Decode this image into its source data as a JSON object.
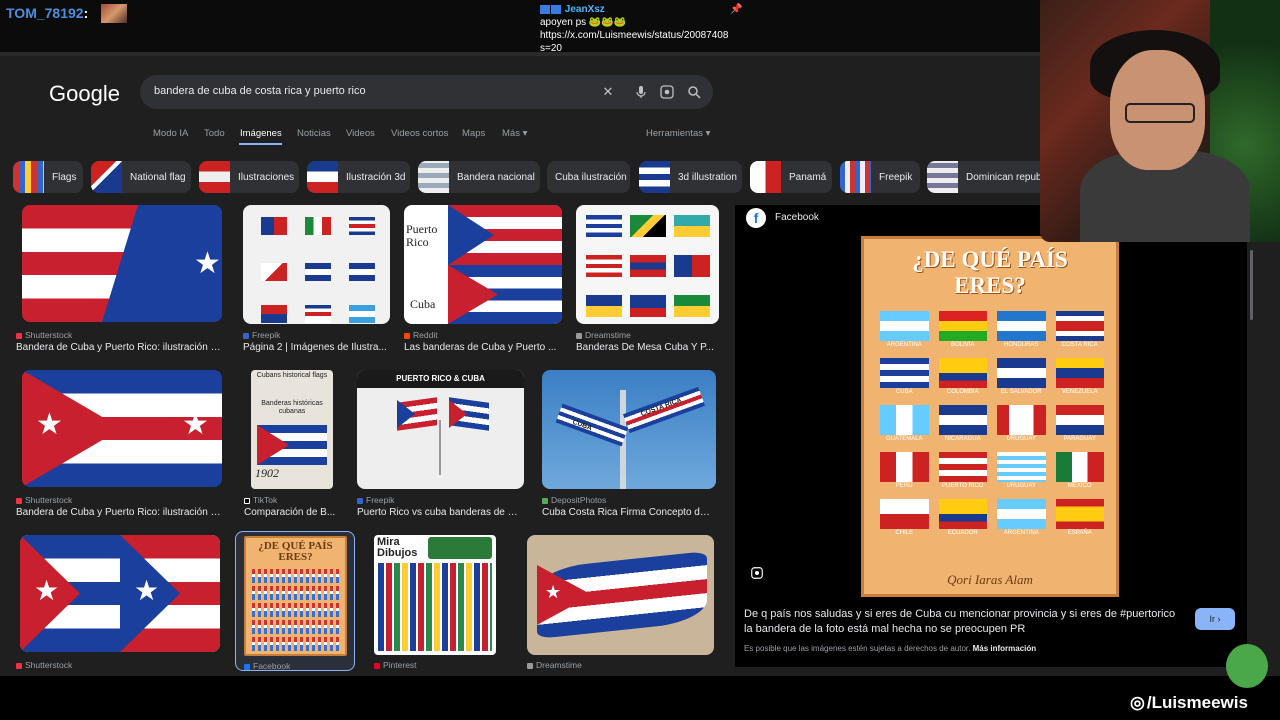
{
  "overlay": {
    "chat_user": "TOM_78192",
    "chat_colon": ":",
    "pinned_nick": "JeanXsz",
    "pinned_line1": "apoyen ps 🐸🐸🐸",
    "pinned_line2": "https://x.com/Luismeewis/status/20087408",
    "pinned_line3": "s=20",
    "social_handle": "/Luismeewis"
  },
  "google": {
    "logo": "Google",
    "query": "bandera de cuba de costa rica y puerto rico",
    "tabs": [
      "Modo IA",
      "Todo",
      "Imágenes",
      "Noticias",
      "Videos",
      "Videos cortos",
      "Maps",
      "Más ▾"
    ],
    "active_tab": "Imágenes",
    "tools": "Herramientas ▾",
    "chips": [
      "Flags",
      "National flag",
      "Ilustraciones",
      "Ilustración 3d",
      "Bandera nacional",
      "Cuba ilustración",
      "3d illustration",
      "Panamá",
      "Freepik",
      "Dominican republ"
    ],
    "results": [
      {
        "source": "Shutterstock",
        "title": "Bandera de Cuba y Puerto Rico: ilustración de ..."
      },
      {
        "source": "Freepik",
        "title": "Página 2 | Imágenes de Ilustra..."
      },
      {
        "source": "Reddit",
        "title": "Las banderas de Cuba y Puerto ..."
      },
      {
        "source": "Dreamstime",
        "title": "Banderas De Mesa Cuba Y P..."
      },
      {
        "source": "Shutterstock",
        "title": "Bandera de Cuba y Puerto Rico: ilustración de ..."
      },
      {
        "source": "TikTok",
        "title": "Comparación de B..."
      },
      {
        "source": "Freepik",
        "title": "Puerto Rico vs cuba banderas de es..."
      },
      {
        "source": "DepositPhotos",
        "title": "Cuba Costa Rica Firma Concepto de ..."
      },
      {
        "source": "Shutterstock",
        "title": ""
      },
      {
        "source": "Facebook",
        "title": ""
      },
      {
        "source": "Pinterest",
        "title": ""
      },
      {
        "source": "Dreamstime",
        "title": ""
      }
    ],
    "thumb_text": {
      "reddit_top": "Puerto Rico",
      "reddit_bottom": "Cuba",
      "tiktok_title": "Cubans historical flags",
      "tiktok_sub": "Banderas históricas cubanas",
      "tiktok_year": "1902",
      "freepik_banner": "PUERTO RICO & CUBA",
      "sign_1": "CUBA",
      "sign_2": "COSTA RICA",
      "fb_mini": "¿DE QUÉ PAÍS ERES?",
      "pin_title": "Mira Dibujos"
    },
    "preview": {
      "site": "Facebook",
      "poster_title_1": "¿DE QUÉ PAÍS",
      "poster_title_2": "ERES?",
      "poster_footer": "Qori Iaras Alam",
      "countries": [
        "ARGENTINA",
        "BOLIVIA",
        "HONDURAS",
        "COSTA RICA",
        "CUBA",
        "COLOMBIA",
        "EL SALVADOR",
        "VENEZUELA",
        "GUATEMALA",
        "NICARAGUA",
        "URUGUAY",
        "PARAGUAY",
        "PERÚ",
        "PUERTO RICO",
        "URUGUAY",
        "MÉXICO",
        "CHILE",
        "ECUADOR",
        "ARGENTINA",
        "ESPAÑA"
      ],
      "caption": "De q país nos saludas y si eres de Cuba cu mencionar provincia y si eres de #puertorico la bandera de la foto está mal hecha no se preocupen PR",
      "rights": "Es posible que las imágenes estén sujetas a derechos de autor.",
      "more_info": "Más información",
      "go_button": "Ir ›"
    }
  },
  "colors": {
    "accent": "#8ab4f8",
    "page_bg": "#1f1f1f",
    "search_bg": "#303134",
    "chat_user": "#4a8fe0"
  }
}
